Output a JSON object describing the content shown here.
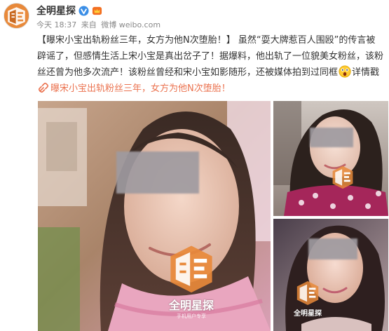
{
  "author": {
    "name": "全明星探",
    "verified": "weibo-verified-badge-icon"
  },
  "meta": {
    "time": "今天 18:37",
    "source_prefix": "来自",
    "source": "微博 weibo.com"
  },
  "post": {
    "headline": "【曝宋小宝出轨粉丝三年，女方为他N次堕胎！】",
    "text_1": "虽然“耍大牌惹百人围殴”的传言被辟谣了，但感情生活上宋小宝是真出岔子了！据爆料，他出轨了一位貌美女粉丝，该粉丝还曾为他多次流产！该粉丝曾经和宋小宝如影随形，还被媒体拍到过同框",
    "emoji": "吃惊",
    "text_2": "详情戳",
    "link": "曝宋小宝出轨粉丝三年，女方为他N次堕胎！"
  },
  "watermark": {
    "brand": "全明星探",
    "sub": "手机用户专享"
  },
  "colors": {
    "link": "#eb7350",
    "logo_orange": "#e8893a",
    "text": "#333333",
    "meta": "#888888"
  }
}
